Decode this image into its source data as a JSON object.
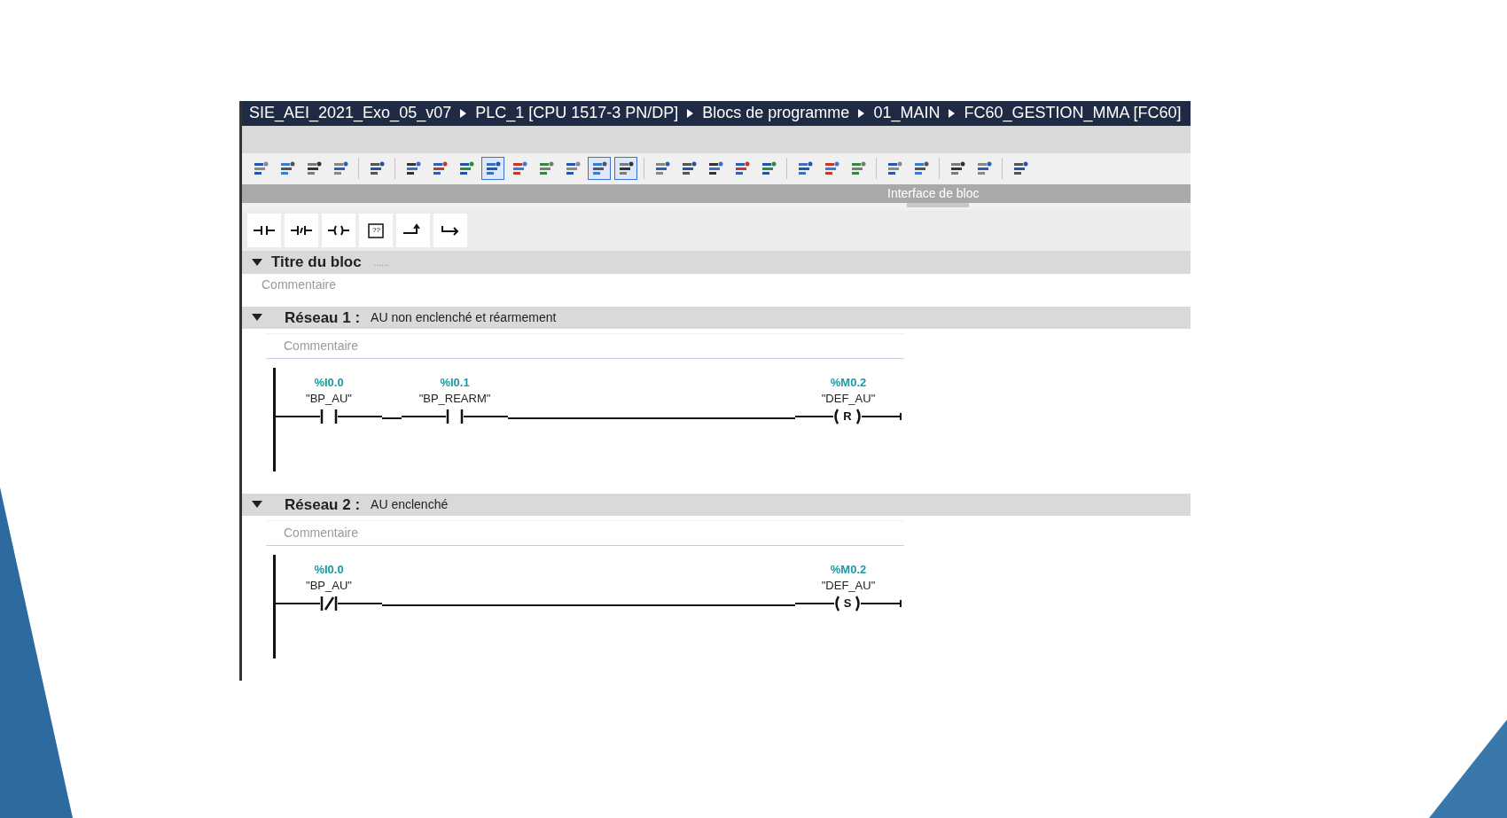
{
  "breadcrumb": [
    "SIE_AEI_2021_Exo_05_v07",
    "PLC_1 [CPU 1517-3 PN/DP]",
    "Blocs de programme",
    "01_MAIN",
    "FC60_GESTION_MMA [FC60]"
  ],
  "toolbar_groups": [
    [
      {
        "pressed": false
      },
      {
        "pressed": false
      },
      {
        "pressed": false
      },
      {
        "pressed": false
      }
    ],
    [
      {
        "pressed": false
      }
    ],
    [
      {
        "pressed": false
      },
      {
        "pressed": false
      },
      {
        "pressed": false
      },
      {
        "pressed": true
      },
      {
        "pressed": false
      },
      {
        "pressed": false
      },
      {
        "pressed": false
      },
      {
        "pressed": true
      },
      {
        "pressed": true
      }
    ],
    [
      {
        "pressed": false
      },
      {
        "pressed": false
      },
      {
        "pressed": false
      },
      {
        "pressed": false
      },
      {
        "pressed": false
      }
    ],
    [
      {
        "pressed": false
      },
      {
        "pressed": false
      },
      {
        "pressed": false
      }
    ],
    [
      {
        "pressed": false
      },
      {
        "pressed": false
      }
    ],
    [
      {
        "pressed": false
      },
      {
        "pressed": false
      }
    ],
    [
      {
        "pressed": false
      }
    ]
  ],
  "interface_bar": {
    "label": "Interface de bloc"
  },
  "palette": [
    {
      "kind": "contact_no"
    },
    {
      "kind": "contact_nc"
    },
    {
      "kind": "coil"
    },
    {
      "kind": "box",
      "label": "??"
    },
    {
      "kind": "branch_open"
    },
    {
      "kind": "branch_close"
    }
  ],
  "block": {
    "title": "Titre du bloc",
    "title_dots": "......",
    "comment": "Commentaire",
    "expanded": true
  },
  "networks": [
    {
      "title": "Réseau 1 :",
      "description": "AU non enclenché et réarmement",
      "comment": "Commentaire",
      "expanded": true,
      "elements": [
        {
          "kind": "contact_no",
          "address": "%I0.0",
          "symbol": "\"BP_AU\""
        },
        {
          "kind": "contact_no",
          "address": "%I0.1",
          "symbol": "\"BP_REARM\""
        },
        {
          "kind": "coil",
          "address": "%M0.2",
          "symbol": "\"DEF_AU\"",
          "letter": "R"
        }
      ]
    },
    {
      "title": "Réseau 2 :",
      "description": "AU enclenché",
      "comment": "Commentaire",
      "expanded": true,
      "elements": [
        {
          "kind": "contact_nc",
          "address": "%I0.0",
          "symbol": "\"BP_AU\""
        },
        {
          "kind": "coil",
          "address": "%M0.2",
          "symbol": "\"DEF_AU\"",
          "letter": "S"
        }
      ]
    }
  ]
}
